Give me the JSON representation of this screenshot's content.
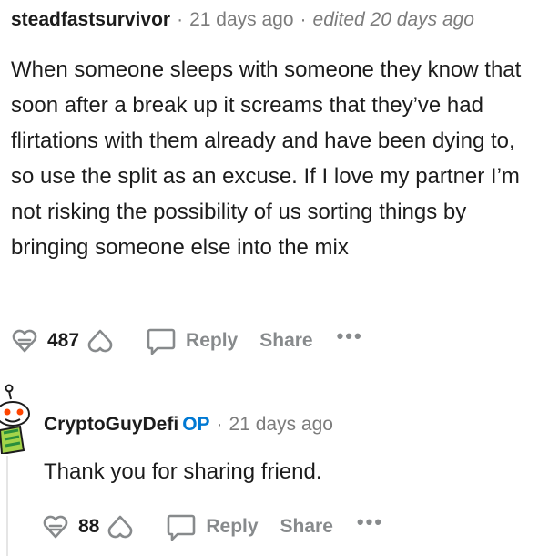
{
  "comments": [
    {
      "author": "steadfastsurvivor",
      "time": "21 days ago",
      "edited": "edited 20 days ago",
      "body": "When someone sleeps with someone they know that soon after a break up it screams that they’ve had flirtations with them already and have been dying to, so use the split as an excuse. If I love my partner I’m not risking the possibility of us sorting things by bringing someone else into the mix",
      "score": "487",
      "reply_label": "Reply",
      "share_label": "Share",
      "more_label": "•••"
    },
    {
      "author": "CryptoGuyDefi",
      "op_badge": "OP",
      "time": "21 days ago",
      "body": "Thank you for sharing friend.",
      "score": "88",
      "reply_label": "Reply",
      "share_label": "Share",
      "more_label": "•••"
    }
  ],
  "icons": {
    "upvote": "upvote-icon",
    "downvote": "downvote-icon",
    "reply": "comment-bubble-icon",
    "avatar": "snoo-avatar-icon"
  },
  "colors": {
    "op_badge": "#0079d3",
    "muted": "#878a8c",
    "text": "#1c1c1c"
  }
}
